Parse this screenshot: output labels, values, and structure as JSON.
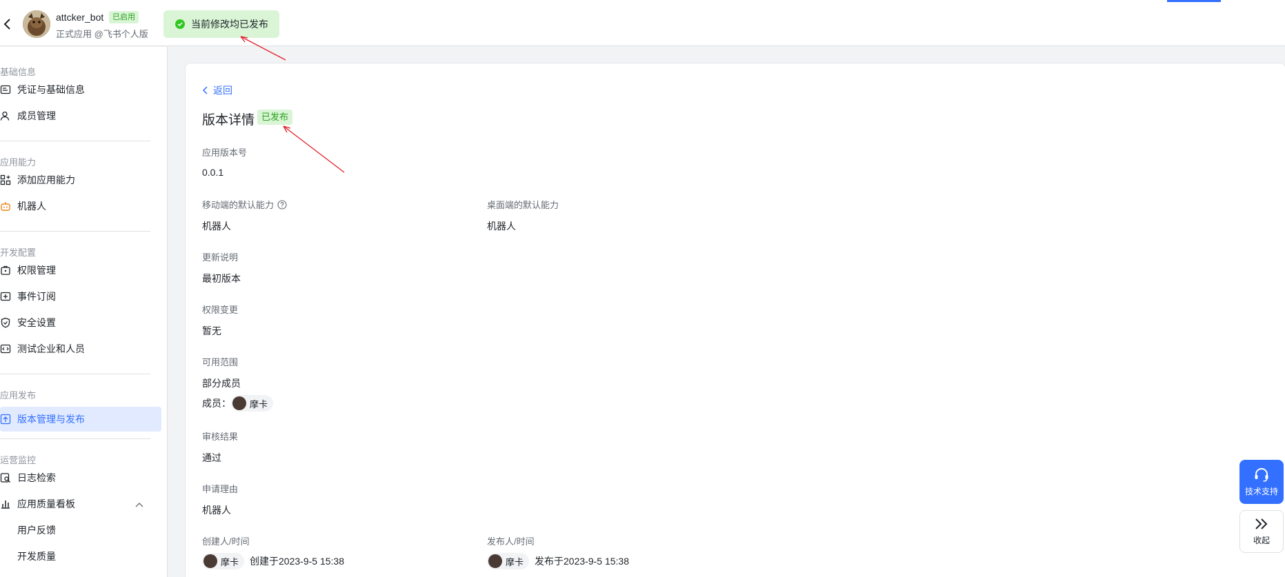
{
  "header": {
    "app_name": "attcker_bot",
    "enabled_badge": "已启用",
    "app_subtitle": "正式应用 @飞书个人版",
    "toast_text": "当前修改均已发布"
  },
  "sidebar": {
    "groups": [
      {
        "title": "基础信息",
        "items": [
          {
            "label": "凭证与基础信息",
            "icon": "credential-icon"
          },
          {
            "label": "成员管理",
            "icon": "member-icon"
          }
        ]
      },
      {
        "title": "应用能力",
        "items": [
          {
            "label": "添加应用能力",
            "icon": "add-capability-icon"
          },
          {
            "label": "机器人",
            "icon": "robot-icon"
          }
        ]
      },
      {
        "title": "开发配置",
        "items": [
          {
            "label": "权限管理",
            "icon": "permission-icon"
          },
          {
            "label": "事件订阅",
            "icon": "event-icon"
          },
          {
            "label": "安全设置",
            "icon": "shield-icon"
          },
          {
            "label": "测试企业和人员",
            "icon": "code-icon"
          }
        ]
      },
      {
        "title": "应用发布",
        "items": [
          {
            "label": "版本管理与发布",
            "icon": "upload-icon",
            "active": true
          }
        ]
      },
      {
        "title": "运营监控",
        "items": [
          {
            "label": "日志检索",
            "icon": "log-search-icon"
          },
          {
            "label": "应用质量看板",
            "icon": "bar-chart-icon"
          },
          {
            "label": "用户反馈"
          },
          {
            "label": "开发质量"
          }
        ]
      }
    ]
  },
  "detail": {
    "back_label": "返回",
    "title": "版本详情",
    "status": "已发布",
    "version_label": "应用版本号",
    "version_value": "0.0.1",
    "mobile_label": "移动端的默认能力",
    "mobile_value": "机器人",
    "desktop_label": "桌面端的默认能力",
    "desktop_value": "机器人",
    "update_label": "更新说明",
    "update_value": "最初版本",
    "perm_label": "权限变更",
    "perm_value": "暂无",
    "scope_label": "可用范围",
    "scope_value": "部分成员",
    "members_prefix": "成员：",
    "member_name": "摩卡",
    "review_label": "审核结果",
    "review_value": "通过",
    "reason_label": "申请理由",
    "reason_value": "机器人",
    "creator_label": "创建人/时间",
    "creator_name": "摩卡",
    "created_text": "创建于2023-9-5 15:38",
    "publisher_label": "发布人/时间",
    "publisher_name": "摩卡",
    "published_text": "发布于2023-9-5 15:38"
  },
  "floating": {
    "support_label": "技术支持",
    "collapse_label": "收起"
  },
  "colors": {
    "accent": "#3370ff",
    "success": "#2ea121",
    "success_bg": "#d9f5d6",
    "annotation_arrow": "#e0202a"
  }
}
